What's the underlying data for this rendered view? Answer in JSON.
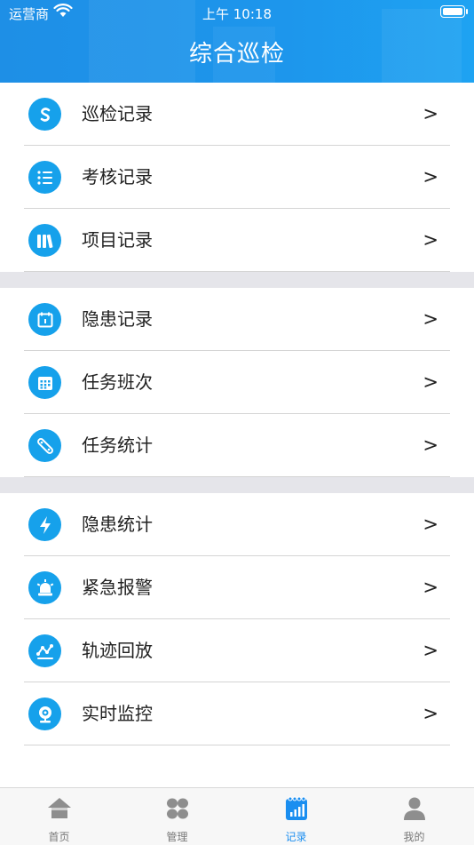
{
  "status_bar": {
    "carrier": "运营商",
    "time": "上午 10:18"
  },
  "header": {
    "title": "综合巡检"
  },
  "groups": [
    {
      "items": [
        {
          "label": "巡检记录",
          "icon": "patrol-record-icon",
          "arrow": ">"
        },
        {
          "label": "考核记录",
          "icon": "list-icon",
          "arrow": ">"
        },
        {
          "label": "项目记录",
          "icon": "books-icon",
          "arrow": ">"
        }
      ]
    },
    {
      "items": [
        {
          "label": "隐患记录",
          "icon": "calendar-icon",
          "arrow": ">"
        },
        {
          "label": "任务班次",
          "icon": "calendar-grid-icon",
          "arrow": ">"
        },
        {
          "label": "任务统计",
          "icon": "clip-icon",
          "arrow": ">"
        }
      ]
    },
    {
      "items": [
        {
          "label": "隐患统计",
          "icon": "lightning-icon",
          "arrow": ">"
        },
        {
          "label": "紧急报警",
          "icon": "alarm-light-icon",
          "arrow": ">"
        },
        {
          "label": "轨迹回放",
          "icon": "track-icon",
          "arrow": ">"
        },
        {
          "label": "实时监控",
          "icon": "webcam-icon",
          "arrow": ">"
        }
      ]
    }
  ],
  "tabbar": {
    "tabs": [
      {
        "label": "首页",
        "icon": "home-icon",
        "active": false
      },
      {
        "label": "管理",
        "icon": "grid-icon",
        "active": false
      },
      {
        "label": "记录",
        "icon": "record-chart-icon",
        "active": true
      },
      {
        "label": "我的",
        "icon": "person-icon",
        "active": false
      }
    ]
  },
  "colors": {
    "header": "#1e8fe6",
    "icon_bg": "#16a1eb",
    "active_tab": "#1a8ef0",
    "inactive_tab": "#777777",
    "separator": "#e5e5ea"
  }
}
